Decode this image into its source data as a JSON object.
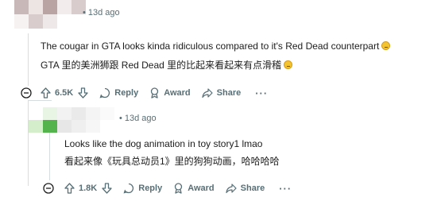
{
  "comments": [
    {
      "time": "13d ago",
      "text_en": "The cougar in GTA looks kinda ridiculous compared to it's Red Dead counterpart",
      "text_zh": "GTA 里的美洲狮跟 Red Dead 里的比起来看起来有点滑稽",
      "score": "6.5K",
      "reply_label": "Reply",
      "award_label": "Award",
      "share_label": "Share",
      "more_label": "···",
      "avatar_colors": [
        "#c9b8b8",
        "#e8dede",
        "#b9a3a3",
        "#f2ecec",
        "#d8cccc",
        "#f6f2f2"
      ]
    },
    {
      "time": "13d ago",
      "text_en": "Looks like the dog animation in toy story1 lmao",
      "text_zh": "看起来像《玩具总动员1》里的狗狗动画，哈哈哈哈",
      "score": "1.8K",
      "reply_label": "Reply",
      "award_label": "Award",
      "share_label": "Share",
      "more_label": "···",
      "avatar_colors": [
        "#e9f5e4",
        "#d4edcb",
        "#cfead0",
        "#bfe4b4",
        "#6cc165",
        "#55b34d",
        "#a6d89c",
        "#eaeaea"
      ]
    }
  ]
}
